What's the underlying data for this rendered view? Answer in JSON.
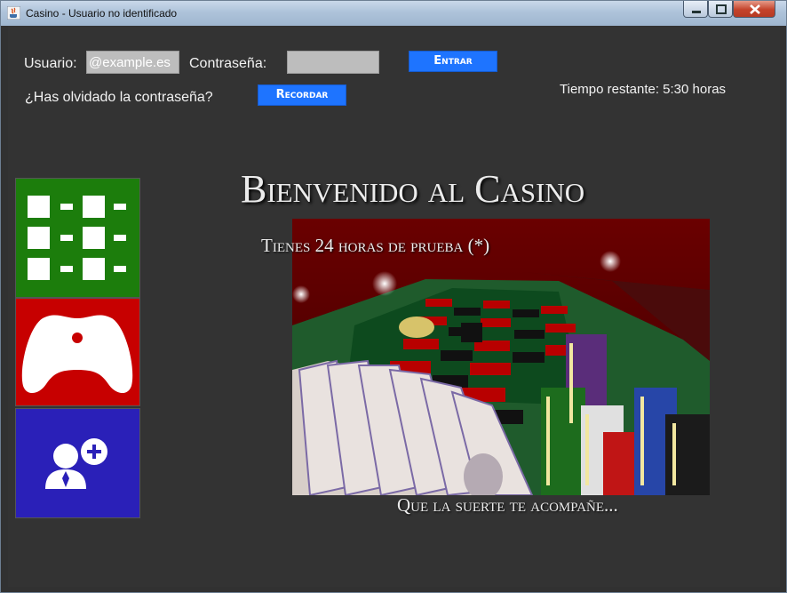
{
  "window": {
    "title": "Casino - Usuario no identificado"
  },
  "login": {
    "user_label": "Usuario:",
    "user_value": "@example.es",
    "password_label": "Contraseña:",
    "password_value": "",
    "login_button": "Entrar",
    "forgot_label": "¿Has olvidado la contraseña?",
    "remind_button": "Recordar"
  },
  "status": {
    "time_remaining": "Tiempo restante: 5:30 horas"
  },
  "sidebar": {
    "tiles": [
      {
        "icon": "grid-icon",
        "color": "#1c7d0c"
      },
      {
        "icon": "gamepad-icon",
        "color": "#c70000"
      },
      {
        "icon": "add-user-icon",
        "color": "#2a20b8"
      }
    ]
  },
  "main": {
    "heading": "Bienvenido al Casino",
    "trial_text": "Tienes 24 horas de prueba (*)",
    "footer_text": "Que la suerte te acompañe..."
  },
  "colors": {
    "accent": "#1e74ff",
    "background": "#333333"
  }
}
